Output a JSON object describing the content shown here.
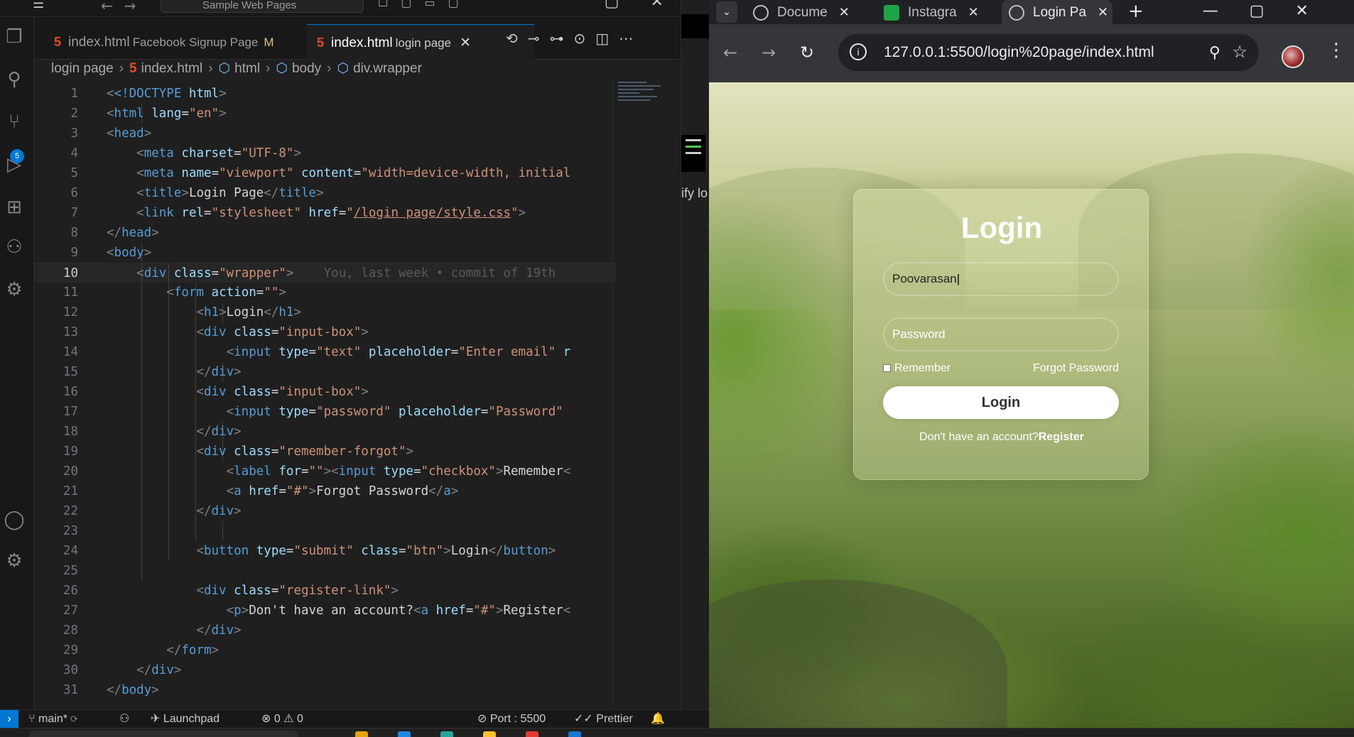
{
  "vscode": {
    "search_placeholder": "Sample Web Pages",
    "scm_badge": "5",
    "tabs": [
      {
        "file": "index.html",
        "desc": "Facebook Signup Page",
        "modified": "M"
      },
      {
        "file": "index.html",
        "desc": "login page",
        "close": "✕"
      }
    ],
    "breadcrumb": [
      "login page",
      "index.html",
      "html",
      "body",
      "div.wrapper"
    ],
    "blame": "You, last week • commit of 19th",
    "status": {
      "branch": "main*",
      "launchpad": "Launchpad",
      "problems": "⊗ 0 ⚠ 0",
      "port": "Port : 5500",
      "prettier": "Prettier"
    },
    "side_text": "ify lo"
  },
  "code_lines": [
    {
      "n": "1"
    },
    {
      "n": "2"
    },
    {
      "n": "3"
    },
    {
      "n": "4"
    },
    {
      "n": "5"
    },
    {
      "n": "6"
    },
    {
      "n": "7"
    },
    {
      "n": "8"
    },
    {
      "n": "9"
    },
    {
      "n": "10"
    },
    {
      "n": "11"
    },
    {
      "n": "12"
    },
    {
      "n": "13"
    },
    {
      "n": "14"
    },
    {
      "n": "15"
    },
    {
      "n": "16"
    },
    {
      "n": "17"
    },
    {
      "n": "18"
    },
    {
      "n": "19"
    },
    {
      "n": "20"
    },
    {
      "n": "21"
    },
    {
      "n": "22"
    },
    {
      "n": "23"
    },
    {
      "n": "24"
    },
    {
      "n": "25"
    },
    {
      "n": "26"
    },
    {
      "n": "27"
    },
    {
      "n": "28"
    },
    {
      "n": "29"
    },
    {
      "n": "30"
    },
    {
      "n": "31"
    }
  ],
  "code": {
    "l1_doctype": "<!DOCTYPE",
    "l1_html": "html",
    "l2_tag": "html",
    "l2_attr": "lang",
    "l2_val": "\"en\"",
    "l3_tag": "head",
    "l4_tag": "meta",
    "l4_attr": "charset",
    "l4_val": "\"UTF-8\"",
    "l5_tag": "meta",
    "l5_attr1": "name",
    "l5_val1": "\"viewport\"",
    "l5_attr2": "content",
    "l5_val2": "\"width=device-width, initial",
    "l6_tag": "title",
    "l6_text": "Login Page",
    "l7_tag": "link",
    "l7_attr1": "rel",
    "l7_val1": "\"stylesheet\"",
    "l7_attr2": "href",
    "l7_val2a": "\"",
    "l7_val2b": "/login page/style.css",
    "l7_val2c": "\"",
    "l8_tag": "head",
    "l9_tag": "body",
    "l10_tag": "div",
    "l10_attr": "class",
    "l10_val": "\"wrapper\"",
    "l11_tag": "form",
    "l11_attr": "action",
    "l11_val": "\"\"",
    "l12_tag": "h1",
    "l12_text": "Login",
    "l13_tag": "div",
    "l13_attr": "class",
    "l13_val": "\"input-box\"",
    "l14_tag": "input",
    "l14_attr1": "type",
    "l14_val1": "\"text\"",
    "l14_attr2": "placeholder",
    "l14_val2": "\"Enter email\"",
    "l14_tail": "r",
    "l15_tag": "div",
    "l16_tag": "div",
    "l16_attr": "class",
    "l16_val": "\"input-box\"",
    "l17_tag": "input",
    "l17_attr1": "type",
    "l17_val1": "\"password\"",
    "l17_attr2": "placeholder",
    "l17_val2": "\"Password\"",
    "l18_tag": "div",
    "l19_tag": "div",
    "l19_attr": "class",
    "l19_val": "\"remember-forgot\"",
    "l20_tag1": "label",
    "l20_attr1": "for",
    "l20_val1": "\"\"",
    "l20_tag2": "input",
    "l20_attr2": "type",
    "l20_val2": "\"checkbox\"",
    "l20_text": "Remember",
    "l21_tag": "a",
    "l21_attr": "href",
    "l21_val": "\"#\"",
    "l21_text": "Forgot Password",
    "l22_tag": "div",
    "l24_tag": "button",
    "l24_attr1": "type",
    "l24_val1": "\"submit\"",
    "l24_attr2": "class",
    "l24_val2": "\"btn\"",
    "l24_text": "Login",
    "l26_tag": "div",
    "l26_attr": "class",
    "l26_val": "\"register-link\"",
    "l27_tag1": "p",
    "l27_text1": "Don't have an account?",
    "l27_tag2": "a",
    "l27_attr": "href",
    "l27_val": "\"#\"",
    "l27_text2": "Register",
    "l28_tag": "div",
    "l29_tag": "form",
    "l30_tag": "div",
    "l31_tag": "body"
  },
  "browser": {
    "tabs": [
      {
        "title": "Docume",
        "icon": "globe-icon"
      },
      {
        "title": "Instagra",
        "icon": "instagram-icon"
      },
      {
        "title": "Login Pa",
        "icon": "globe-icon"
      }
    ],
    "url": "127.0.0.1:5500/login%20page/index.html",
    "page": {
      "title": "Login",
      "email_value": "Poovarasan",
      "password_placeholder": "Password",
      "remember": "Remember",
      "forgot": "Forgot Password",
      "login_button": "Login",
      "no_account": "Don't have an account?",
      "register": "Register"
    }
  }
}
